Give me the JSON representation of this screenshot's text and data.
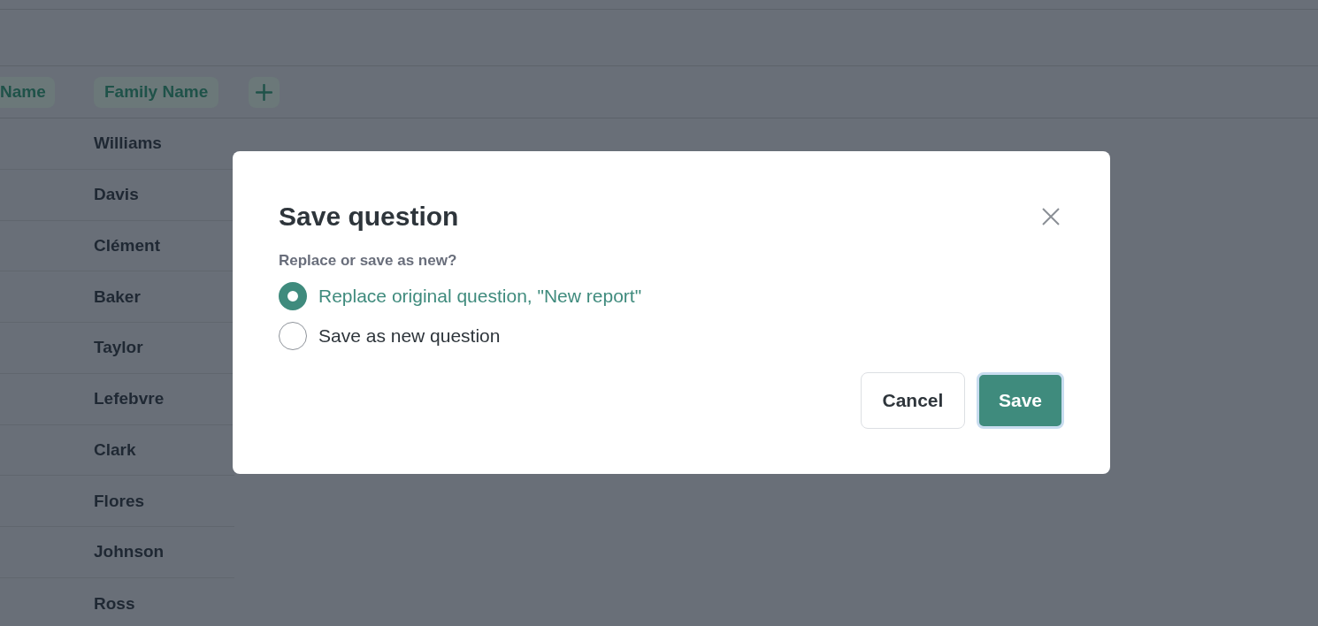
{
  "table": {
    "columns": [
      {
        "label": "Name"
      },
      {
        "label": "Family Name"
      }
    ],
    "rows": [
      {
        "family_name": "Williams"
      },
      {
        "family_name": "Davis"
      },
      {
        "family_name": "Clément"
      },
      {
        "family_name": "Baker"
      },
      {
        "family_name": "Taylor"
      },
      {
        "family_name": "Lefebvre"
      },
      {
        "family_name": "Clark"
      },
      {
        "family_name": "Flores"
      },
      {
        "family_name": "Johnson"
      },
      {
        "family_name": "Ross"
      }
    ]
  },
  "dialog": {
    "title": "Save question",
    "prompt": "Replace or save as new?",
    "options": [
      {
        "label": "Replace original question, \"New report\"",
        "selected": true
      },
      {
        "label": "Save as new question",
        "selected": false
      }
    ],
    "buttons": [
      {
        "label": "Cancel",
        "kind": "secondary",
        "focused": false
      },
      {
        "label": "Save",
        "kind": "primary",
        "focused": true
      }
    ]
  }
}
